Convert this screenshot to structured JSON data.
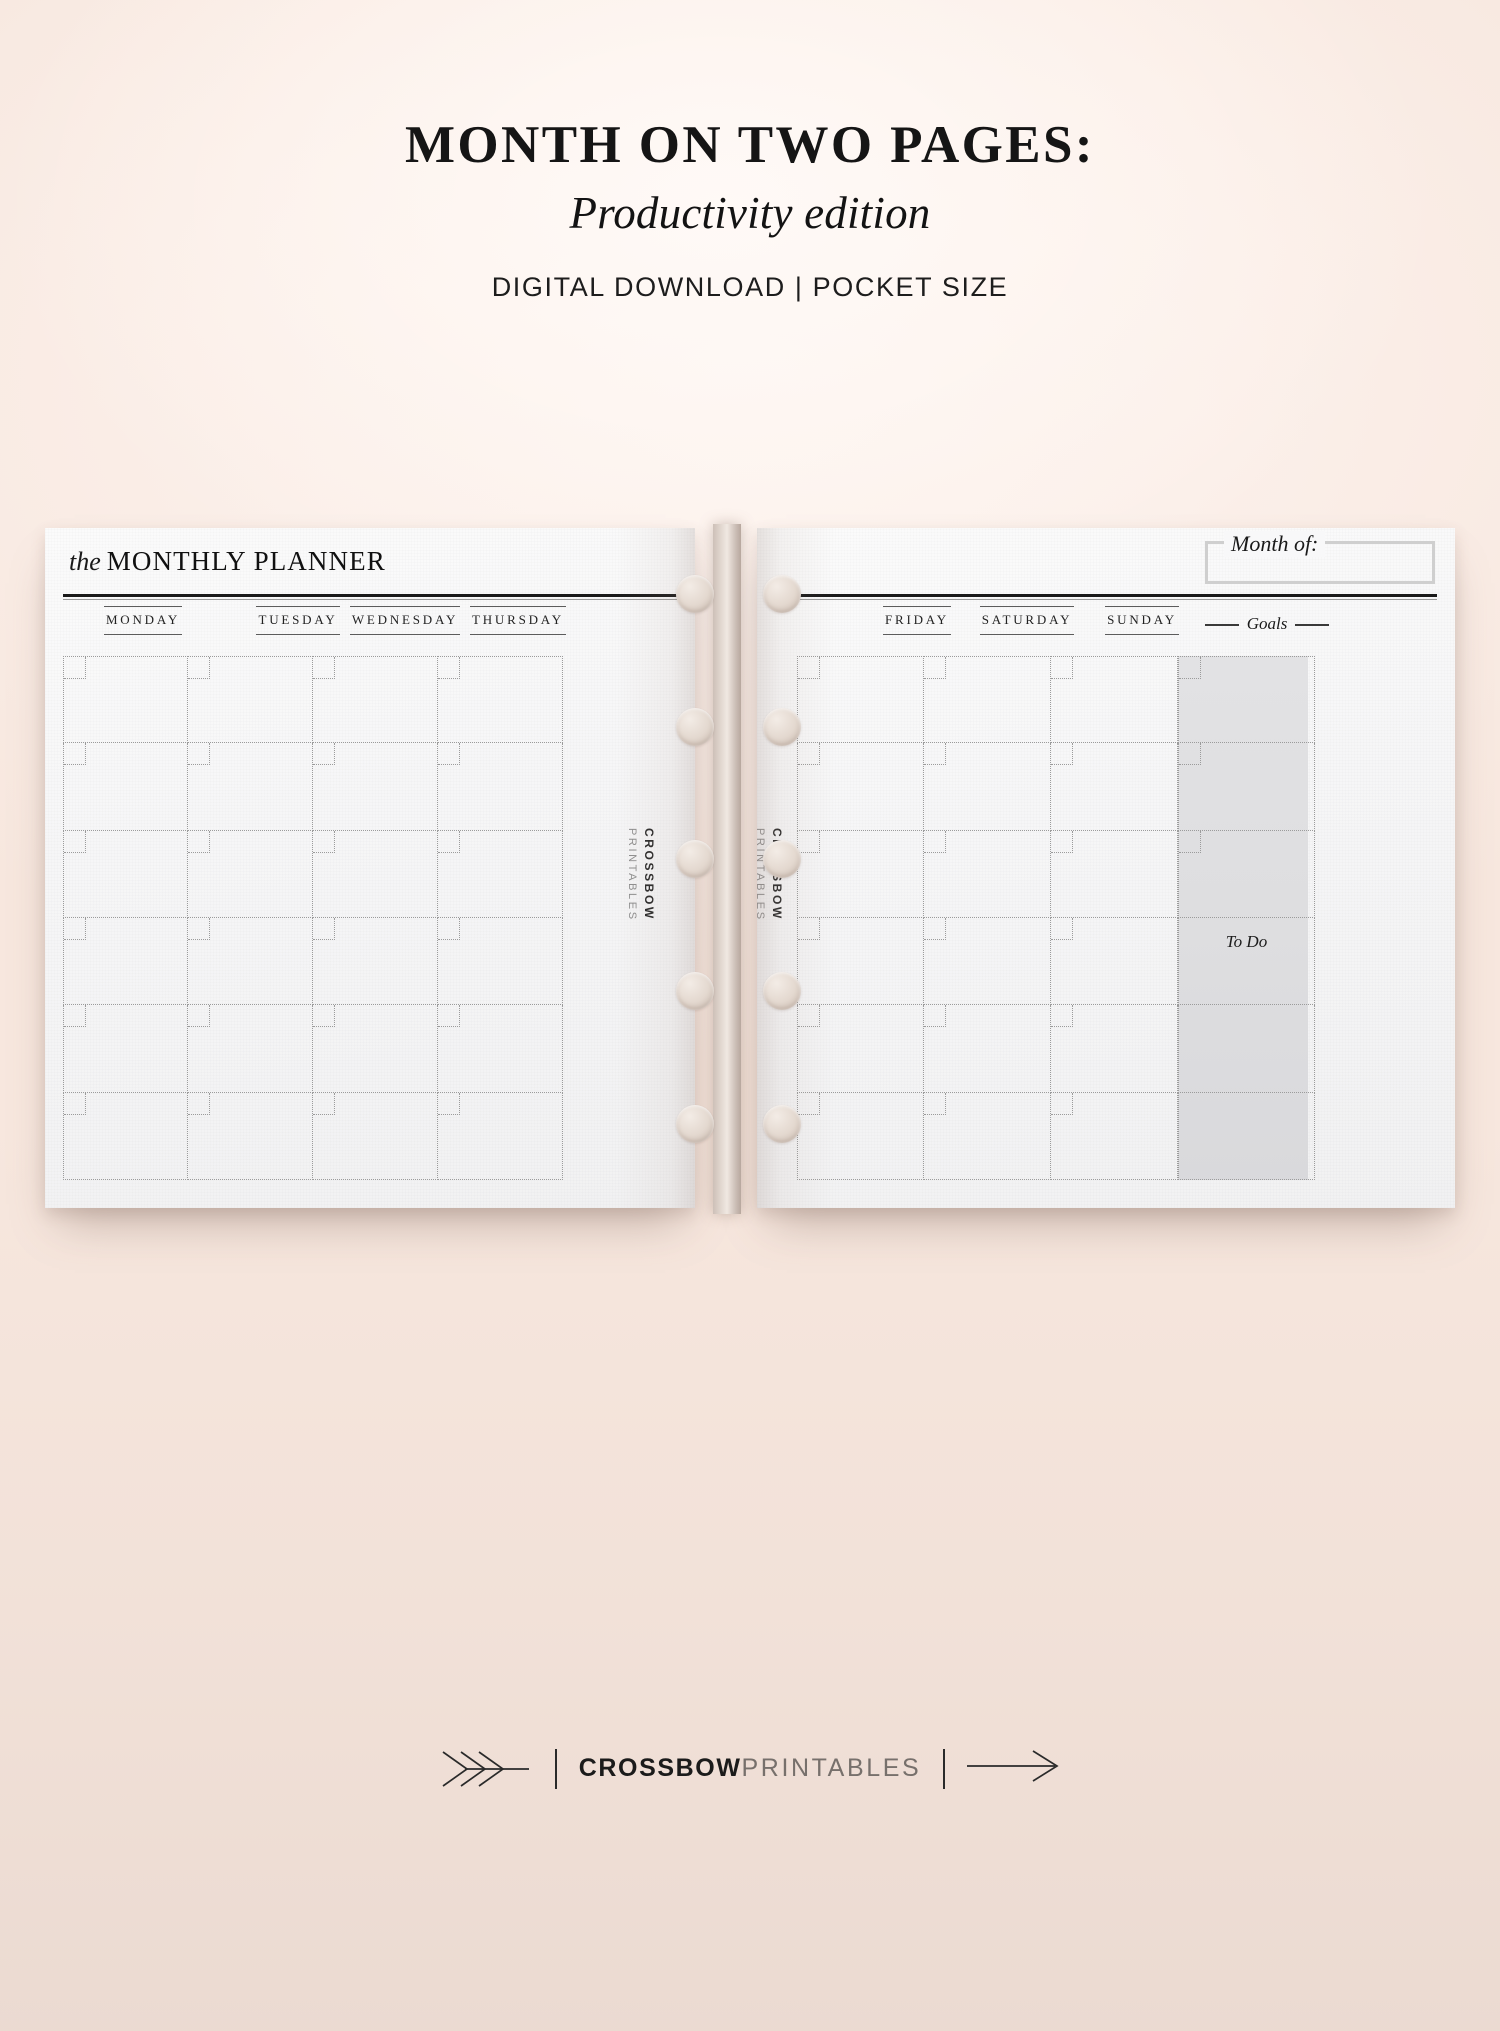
{
  "header": {
    "title": "MONTH ON TWO PAGES:",
    "subtitle": "Productivity edition",
    "tagline": "DIGITAL DOWNLOAD | POCKET SIZE"
  },
  "planner": {
    "left_page": {
      "title_italic": "the",
      "title_caps": "MONTHLY PLANNER",
      "weekdays": [
        "MONDAY",
        "TUESDAY",
        "WEDNESDAY",
        "THURSDAY"
      ],
      "rows": 6,
      "brand_line1": "CROSSBOW",
      "brand_line2": "PRINTABLES"
    },
    "right_page": {
      "month_of_label": "Month of:",
      "month_of_value": "",
      "weekdays": [
        "FRIDAY",
        "SATURDAY",
        "SUNDAY"
      ],
      "goals_label": "Goals",
      "todo_label": "To Do",
      "rows": 6,
      "brand_line1": "CROSSBOW",
      "brand_line2": "PRINTABLES"
    }
  },
  "footer": {
    "brand_bold": "CROSSBOW",
    "brand_light": "PRINTABLES"
  },
  "colors": {
    "background": "#fbefe9",
    "paper": "#f6f6f7",
    "ink": "#1a1a1a",
    "rule": "#5c5c5c",
    "dotted": "#9b9b9b",
    "goals_panel": "#dedee0",
    "ring": "#e4d9d0"
  }
}
